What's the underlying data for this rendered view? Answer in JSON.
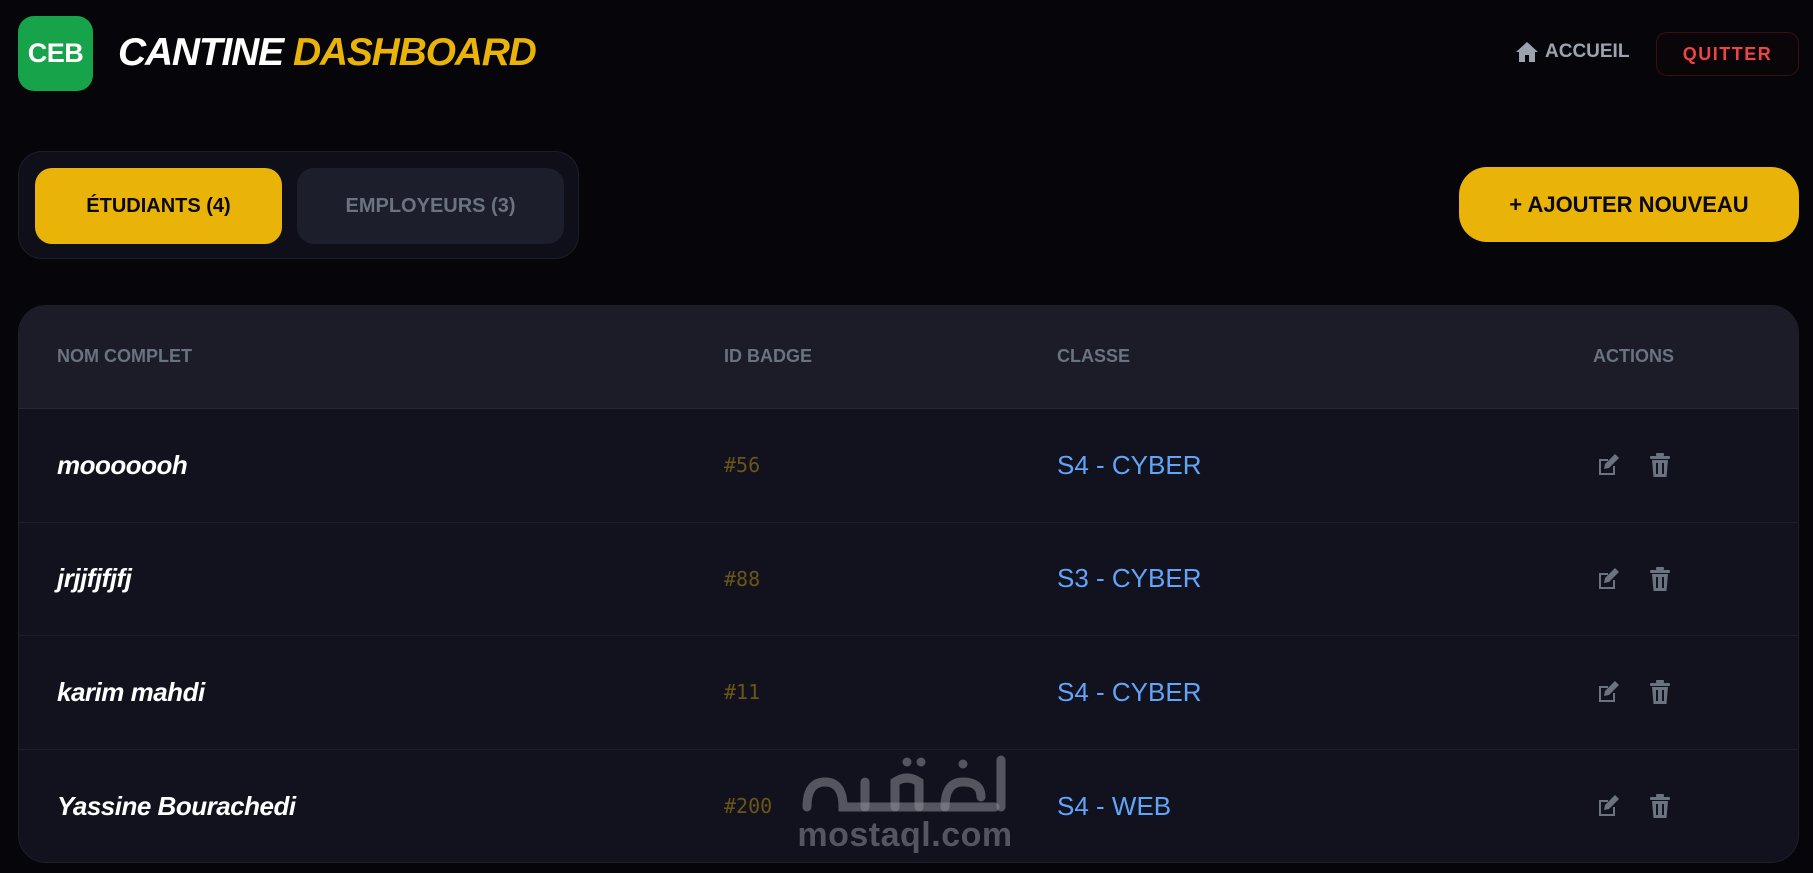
{
  "header": {
    "logo_text": "CEB",
    "logo_color": "#16a34a",
    "title_part1": "CANTINE",
    "title_part2": "DASHBOARD",
    "accent_color": "#eab308",
    "home_label": "ACCUEIL",
    "home_icon": "home-icon",
    "quit_label": "QUITTER"
  },
  "tabs": [
    {
      "label": "ÉTUDIANTS (4)",
      "active": true
    },
    {
      "label": "EMPLOYEURS (3)",
      "active": false
    }
  ],
  "add_button_label": "+ AJOUTER NOUVEAU",
  "table": {
    "columns": [
      "NOM COMPLET",
      "ID BADGE",
      "CLASSE",
      "ACTIONS"
    ],
    "rows": [
      {
        "name": "mooooooh",
        "badge": "#56",
        "classe": "S4 - CYBER"
      },
      {
        "name": "jrjjfjfjfj",
        "badge": "#88",
        "classe": "S3 - CYBER"
      },
      {
        "name": "karim mahdi",
        "badge": "#11",
        "classe": "S4 - CYBER"
      },
      {
        "name": "Yassine Bourachedi",
        "badge": "#200",
        "classe": "S4 - WEB"
      }
    ],
    "row_action_icons": [
      "edit-icon",
      "trash-icon"
    ]
  },
  "watermark": {
    "text": "mostaql.com",
    "logo_text": "مستقل"
  }
}
